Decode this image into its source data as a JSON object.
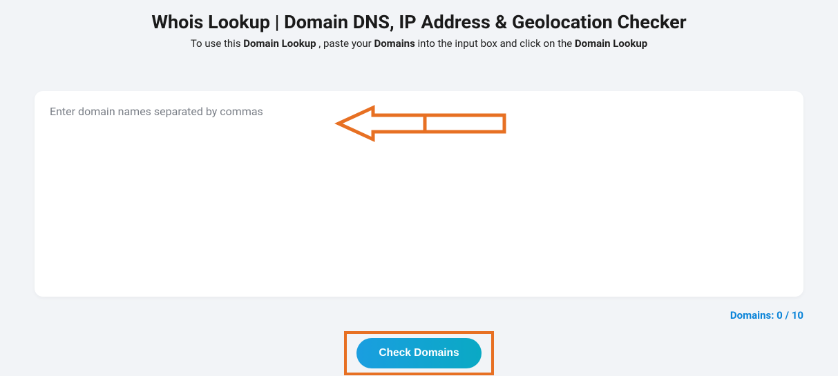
{
  "header": {
    "title": "Whois Lookup | Domain DNS, IP Address & Geolocation Checker",
    "sub_prefix": "To use this ",
    "sub_bold1": "Domain Lookup",
    "sub_mid1": " , paste your ",
    "sub_bold2": "Domains",
    "sub_mid2": "  into the input box and click on the ",
    "sub_bold3": "Domain Lookup"
  },
  "input": {
    "placeholder": "Enter domain names separated by commas",
    "value": ""
  },
  "counter": {
    "label": "Domains: 0 / 10"
  },
  "button": {
    "label": "Check Domains"
  },
  "colors": {
    "annotation": "#e77023",
    "link": "#0b84d8"
  }
}
